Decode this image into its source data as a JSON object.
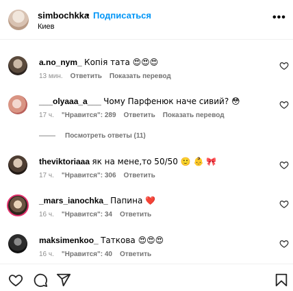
{
  "header": {
    "username": "simbochkka",
    "separator": "•",
    "follow_label": "Подписаться",
    "location": "Киев",
    "more_label": "•••"
  },
  "comments": [
    {
      "user": "a.no_nym_",
      "text": "Копія тата 😍😍😍",
      "time": "13 мин.",
      "likes": "",
      "reply": "Ответить",
      "translate": "Показать перевод"
    },
    {
      "user": "___olyaaa_a___",
      "text": "Чому Парфенюк наче сивий? 😳",
      "time": "17 ч.",
      "likes": "\"Нравится\": 289",
      "reply": "Ответить",
      "translate": "Показать перевод"
    },
    {
      "user": "theviktoriaaa",
      "text": "як на мене,то 50/50 🙂 👶 🎀",
      "time": "17 ч.",
      "likes": "\"Нравится\": 306",
      "reply": "Ответить"
    },
    {
      "user": "_mars_ianochka_",
      "text": "Папина ❤️",
      "time": "16 ч.",
      "likes": "\"Нравится\": 34",
      "reply": "Ответить"
    },
    {
      "user": "maksimenkoo_",
      "text": "Таткова 😍😍😍",
      "time": "16 ч.",
      "likes": "\"Нравится\": 40",
      "reply": "Ответить"
    }
  ],
  "view_replies": "Посмотреть ответы (11)",
  "icons": {
    "heart": "heart-icon",
    "comment": "comment-icon",
    "share": "send-icon",
    "save": "bookmark-icon"
  }
}
